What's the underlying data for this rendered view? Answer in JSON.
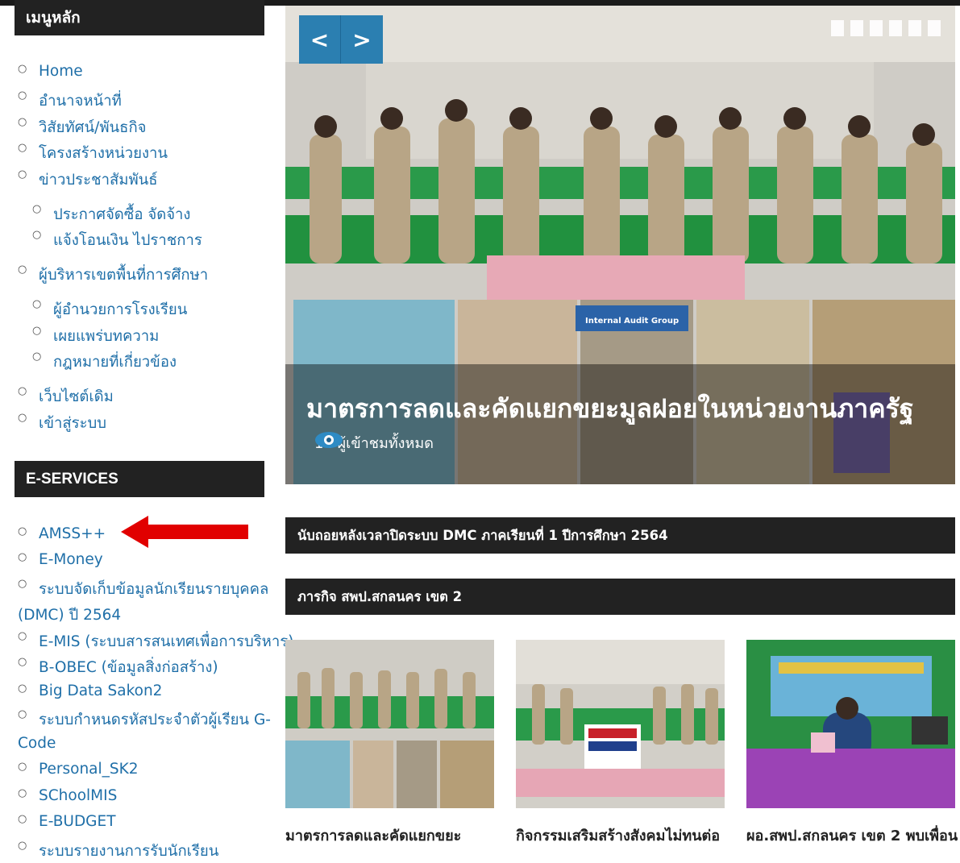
{
  "sidebar": {
    "menu_title": "เมนูหลัก",
    "menu_items": [
      {
        "label": "Home"
      },
      {
        "label": "อำนาจหน้าที่"
      },
      {
        "label": "วิสัยทัศน์/พันธกิจ"
      },
      {
        "label": "โครงสร้างหน่วยงาน"
      },
      {
        "label": "ข่าวประชาสัมพันธ์"
      },
      {
        "label": "ประกาศจัดซื้อ จัดจ้าง"
      },
      {
        "label": "แจ้งโอนเงิน ไปราชการ"
      },
      {
        "label": "ผู้บริหารเขตพื้นที่การศึกษา"
      },
      {
        "label": "ผู้อำนวยการโรงเรียน"
      },
      {
        "label": "เผยแพร่บทความ"
      },
      {
        "label": "กฎหมายที่เกี่ยวข้อง"
      },
      {
        "label": "เว็บไซต์เดิม"
      },
      {
        "label": "เข้าสู่ระบบ"
      }
    ],
    "eservices_title": "E-SERVICES",
    "eservices_items": [
      {
        "label": "AMSS++"
      },
      {
        "label": "E-Money"
      },
      {
        "label": "ระบบจัดเก็บข้อมูลนักเรียนรายบุคคล",
        "label2": "(DMC) ปี 2564"
      },
      {
        "label": "E-MIS (ระบบสารสนเทศเพื่อการบริหาร)"
      },
      {
        "label": "B-OBEC (ข้อมูลสิ่งก่อสร้าง)"
      },
      {
        "label": "Big Data Sakon2"
      },
      {
        "label": "ระบบกำหนดรหัสประจำตัวผู้เรียน G-",
        "label2": "Code"
      },
      {
        "label": "Personal_SK2"
      },
      {
        "label": "SChoolMIS"
      },
      {
        "label": "E-BUDGET"
      },
      {
        "label": "ระบบรายงานการรับนักเรียน"
      }
    ]
  },
  "slider": {
    "prev_icon": "<",
    "next_icon": ">",
    "title": "มาตรการลดและคัดแยกขยะมูลฝอยในหน่วยงานภาครัฐ",
    "views": "14 ผู้เข้าชมทั้งหมด",
    "photo_sign": "Internal Audit Group"
  },
  "sections": {
    "countdown": "นับถอยหลังเวลาปิดระบบ DMC ภาคเรียนที่ 1 ปีการศึกษา 2564",
    "activities": "ภารกิจ สพป.สกลนคร เขต 2"
  },
  "cards": [
    {
      "title": "มาตรการลดและคัดแยกขยะ"
    },
    {
      "title": "กิจกรรมเสริมสร้างสังคมไม่ทนต่อ"
    },
    {
      "title": "ผอ.สพป.สกลนคร เขต 2 พบเพื่อน"
    }
  ],
  "colors": {
    "link": "#1f6fa8",
    "header_bg": "#222222",
    "accent_blue": "#2b7fb1",
    "arrow": "#e10000"
  }
}
